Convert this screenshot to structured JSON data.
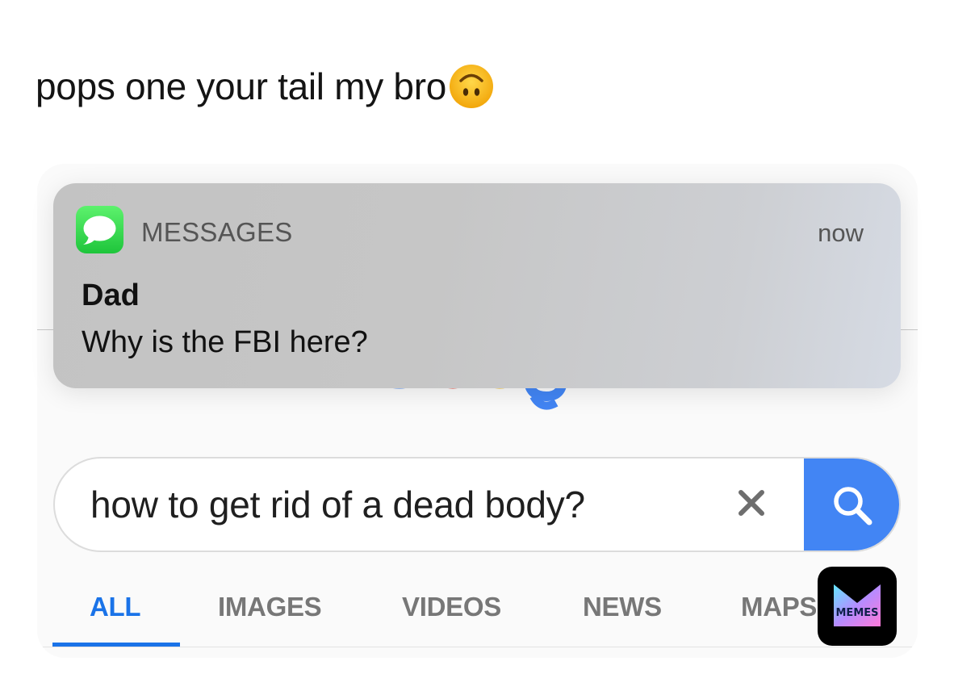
{
  "caption": {
    "text": "pops one your tail my bro",
    "emoji_icon": "upside-down-face-icon"
  },
  "notification": {
    "app_name": "MESSAGES",
    "time": "now",
    "sender": "Dad",
    "message": "Why is the FBI here?",
    "app_icon": "speech-bubble-icon"
  },
  "search": {
    "query": "how to get rid of a dead body?",
    "clear_icon": "close-icon",
    "button_icon": "search-icon",
    "button_color": "#4285f4"
  },
  "tabs": [
    {
      "label": "ALL",
      "active": true
    },
    {
      "label": "IMAGES",
      "active": false
    },
    {
      "label": "VIDEOS",
      "active": false
    },
    {
      "label": "NEWS",
      "active": false
    },
    {
      "label": "MAPS",
      "active": false
    }
  ],
  "colors": {
    "accent": "#1a73e8",
    "messages_green": "#27c940"
  },
  "watermark": {
    "label": "MEMES"
  }
}
